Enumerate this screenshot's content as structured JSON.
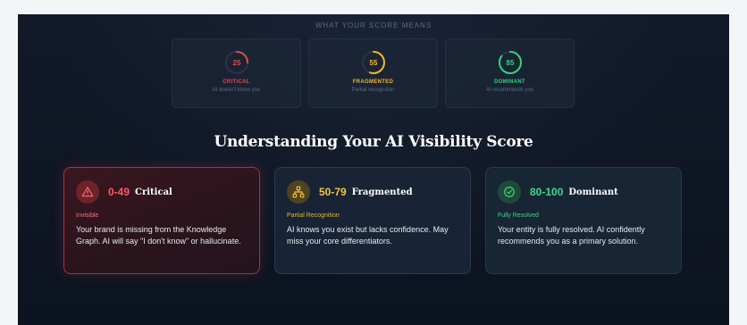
{
  "score_means": {
    "heading": "WHAT YOUR SCORE MEANS",
    "items": [
      {
        "score": "25",
        "progress": 0.25,
        "label": "CRITICAL",
        "sub": "AI doesn't know you",
        "color": "#e5484d"
      },
      {
        "score": "55",
        "progress": 0.55,
        "label": "FRAGMENTED",
        "sub": "Partial recognition",
        "color": "#f1b82d"
      },
      {
        "score": "85",
        "progress": 0.85,
        "label": "DOMINANT",
        "sub": "AI recommends you",
        "color": "#34d37a"
      }
    ]
  },
  "headline": "Understanding Your AI Visibility Score",
  "cards": [
    {
      "icon": "warning-icon",
      "range": "0-49",
      "tier": "Critical",
      "tag": "Invisible",
      "desc": "Your brand is missing from the Knowledge Graph. AI will say \"I don't know\" or hallucinate.",
      "color": "#ff5a60",
      "tag_color": "#f0787c"
    },
    {
      "icon": "network-icon",
      "range": "50-79",
      "tier": "Fragmented",
      "tag": "Partial Recognition",
      "desc": "AI knows you exist but lacks confidence. May miss your core differentiators.",
      "color": "#f5c33b",
      "tag_color": "#e8b634"
    },
    {
      "icon": "check-circle-icon",
      "range": "80-100",
      "tier": "Dominant",
      "tag": "Fully Resolved",
      "desc": "Your entity is fully resolved. AI confidently recommends you as a primary solution.",
      "color": "#3fd98a",
      "tag_color": "#3fd98a"
    }
  ]
}
